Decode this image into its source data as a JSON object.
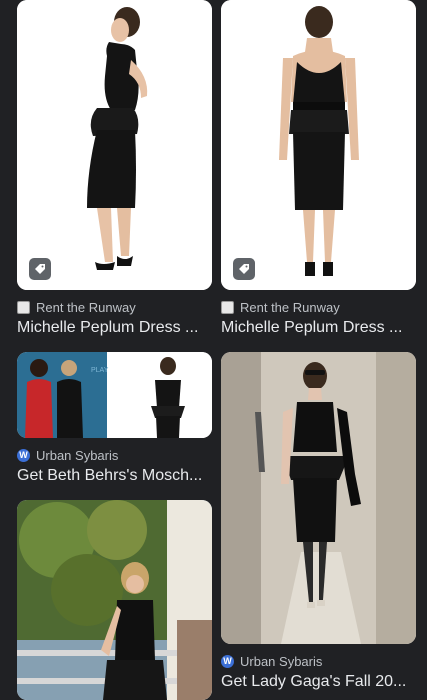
{
  "results": [
    {
      "source": "Rent the Runway",
      "title": "Michelle Peplum Dress ..."
    },
    {
      "source": "Rent the Runway",
      "title": "Michelle Peplum Dress ..."
    },
    {
      "source": "Urban Sybaris",
      "title": "Get Beth Behrs's Mosch..."
    },
    {
      "source": "Urban Sybaris",
      "title": "Get Lady Gaga's Fall 20..."
    }
  ],
  "favicons": {
    "rent_the_runway": "generic-page-icon",
    "urban_sybaris": "wordpress-icon"
  },
  "photo_text": "PLAY",
  "icons": {
    "tag": "shopping-tag-icon"
  },
  "colors": {
    "background": "#202124",
    "card_text": "#e8eaed",
    "source_text": "#bdc1c6"
  }
}
